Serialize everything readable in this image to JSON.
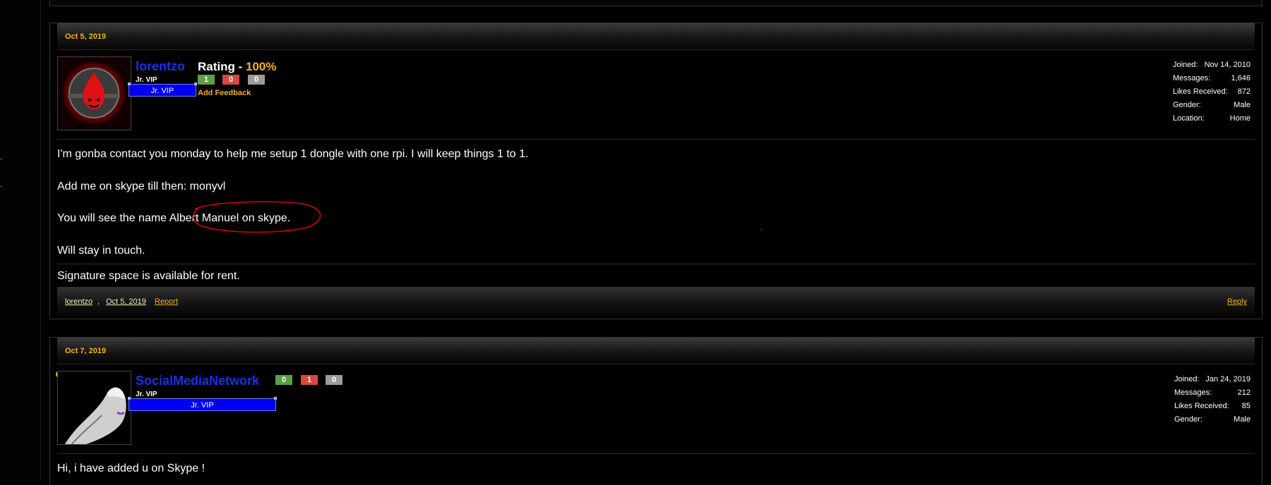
{
  "posts": [
    {
      "date": "Oct 5, 2019",
      "username": "lorentzo",
      "user_title": "Jr. VIP",
      "banner": "Jr. VIP",
      "rating_label": "Rating - ",
      "rating_pct": "100%",
      "feedback": {
        "positive": "1",
        "negative": "0",
        "neutral": "0"
      },
      "add_feedback": "Add Feedback",
      "stats": [
        {
          "label": "Joined:",
          "value": "Nov 14, 2010"
        },
        {
          "label": "Messages:",
          "value": "1,646"
        },
        {
          "label": "Likes Received:",
          "value": "872"
        },
        {
          "label": "Gender:",
          "value": "Male"
        },
        {
          "label": "Location:",
          "value": "Home"
        }
      ],
      "message_lines": [
        "I'm gonba contact you monday to help me setup 1 dongle with one rpi. I will keep things 1 to 1.",
        "Add me on skype till then: monyvl",
        "You will see the name Albert Manuel on skype.",
        "Will stay in touch."
      ],
      "signature": "Signature space is available for rent.",
      "footer": {
        "author": "lorentzo",
        "sep": ",",
        "date": "Oct 5, 2019",
        "report": "Report",
        "reply": "Reply"
      },
      "annotation_color": "#e00000"
    },
    {
      "date": "Oct 7, 2019",
      "username": "SocialMediaNetwork",
      "user_title": "Jr. VIP",
      "banner": "Jr. VIP",
      "feedback": {
        "positive": "0",
        "negative": "1",
        "neutral": "0"
      },
      "stats": [
        {
          "label": "Joined:",
          "value": "Jan 24, 2019"
        },
        {
          "label": "Messages:",
          "value": "212"
        },
        {
          "label": "Likes Received:",
          "value": "85"
        },
        {
          "label": "Gender:",
          "value": "Male"
        }
      ],
      "message_lines": [
        "Hi, i have added u on Skype !"
      ]
    }
  ],
  "colors": {
    "accent": "#f6b21b",
    "username": "#1b30e6",
    "banner": "#0000f0"
  }
}
